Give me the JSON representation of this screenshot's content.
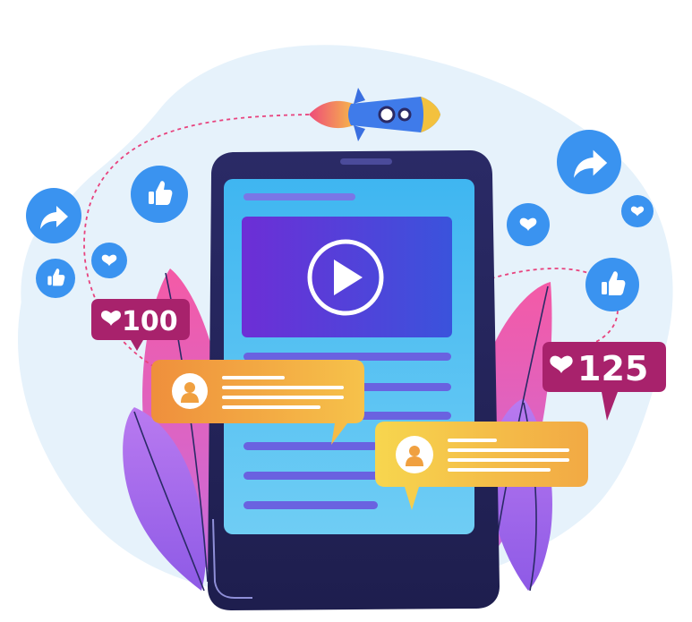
{
  "like_counters": {
    "left": {
      "count": "100"
    },
    "right": {
      "count": "125"
    }
  },
  "icons": {
    "share": "share-arrow-icon",
    "like": "thumbs-up-icon",
    "heart": "heart-icon",
    "play": "play-icon",
    "rocket": "rocket-icon",
    "avatar": "user-avatar-icon"
  },
  "colors": {
    "backdrop_blob": "#e6f2fb",
    "reaction_blue": "#3a93f0",
    "tablet_frame": "#28275e",
    "tablet_screen": "#3cb2ef",
    "video_panel": "#6a2ed8",
    "counter_badge": "#a8226c",
    "comment_orange": "#f0a040",
    "comment_yellow": "#f5c94a",
    "leaf_pink": "#f064a8",
    "leaf_purple": "#a366e8"
  }
}
